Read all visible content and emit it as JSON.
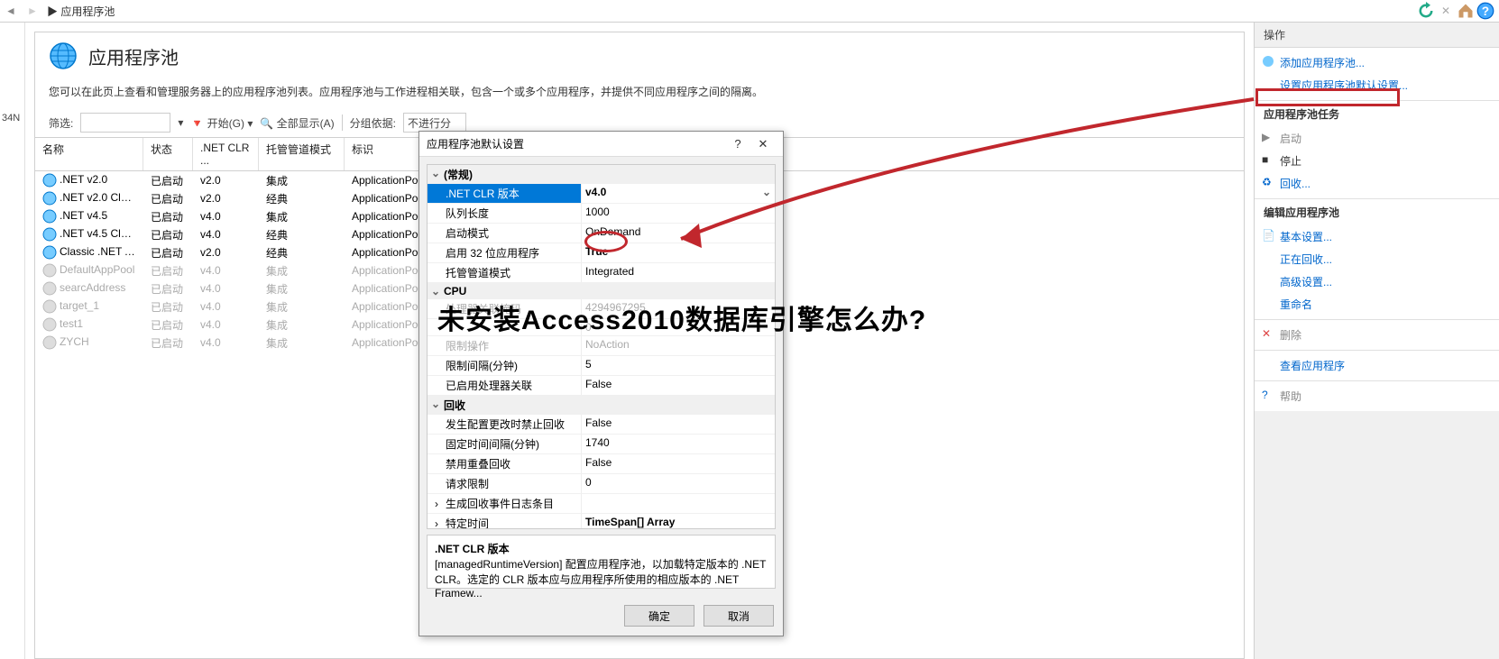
{
  "breadcrumb": "▶ 应用程序池",
  "page_title": "应用程序池",
  "page_description": "您可以在此页上查看和管理服务器上的应用程序池列表。应用程序池与工作进程相关联，包含一个或多个应用程序，并提供不同应用程序之间的隔离。",
  "left_text": "34N",
  "filter": {
    "label": "筛选:",
    "start_label": "开始(G)",
    "show_all": "全部显示(A)",
    "group_by": "分组依据:",
    "group_value": "不进行分"
  },
  "columns": [
    "名称",
    "状态",
    ".NET CLR ...",
    "托管管道模式",
    "标识"
  ],
  "rows": [
    {
      "name": ".NET v2.0",
      "status": "已启动",
      "clr": "v2.0",
      "pipeline": "集成",
      "identity": "ApplicationPoo",
      "disabled": false
    },
    {
      "name": ".NET v2.0 Clas...",
      "status": "已启动",
      "clr": "v2.0",
      "pipeline": "经典",
      "identity": "ApplicationPoo",
      "disabled": false
    },
    {
      "name": ".NET v4.5",
      "status": "已启动",
      "clr": "v4.0",
      "pipeline": "集成",
      "identity": "ApplicationPoo",
      "disabled": false
    },
    {
      "name": ".NET v4.5 Clas...",
      "status": "已启动",
      "clr": "v4.0",
      "pipeline": "经典",
      "identity": "ApplicationPoo",
      "disabled": false
    },
    {
      "name": "Classic .NET A...",
      "status": "已启动",
      "clr": "v2.0",
      "pipeline": "经典",
      "identity": "ApplicationPoo",
      "disabled": false
    },
    {
      "name": "DefaultAppPool",
      "status": "已启动",
      "clr": "v4.0",
      "pipeline": "集成",
      "identity": "ApplicationPoo",
      "disabled": true
    },
    {
      "name": "searcAddress",
      "status": "已启动",
      "clr": "v4.0",
      "pipeline": "集成",
      "identity": "ApplicationPoo",
      "disabled": true
    },
    {
      "name": "target_1",
      "status": "已启动",
      "clr": "v4.0",
      "pipeline": "集成",
      "identity": "ApplicationPoo",
      "disabled": true
    },
    {
      "name": "test1",
      "status": "已启动",
      "clr": "v4.0",
      "pipeline": "集成",
      "identity": "ApplicationPoo",
      "disabled": true
    },
    {
      "name": "ZYCH",
      "status": "已启动",
      "clr": "v4.0",
      "pipeline": "集成",
      "identity": "ApplicationPoo",
      "disabled": true
    }
  ],
  "actions": {
    "title": "操作",
    "add_pool": "添加应用程序池...",
    "set_defaults": "设置应用程序池默认设置...",
    "tasks_title": "应用程序池任务",
    "start": "启动",
    "stop": "停止",
    "recycle": "回收...",
    "edit_title": "编辑应用程序池",
    "basic": "基本设置...",
    "recycling": "正在回收...",
    "advanced": "高级设置...",
    "rename": "重命名",
    "delete": "删除",
    "view_apps": "查看应用程序",
    "help": "帮助"
  },
  "dialog": {
    "title": "应用程序池默认设置",
    "sections": {
      "general": "(常规)",
      "cpu": "CPU",
      "recycle": "回收"
    },
    "props": {
      "clr_version": {
        "k": ".NET CLR 版本",
        "v": "v4.0"
      },
      "queue_length": {
        "k": "队列长度",
        "v": "1000"
      },
      "start_mode": {
        "k": "启动模式",
        "v": "OnDemand"
      },
      "enable_32bit": {
        "k": "启用 32 位应用程序",
        "v": "True"
      },
      "managed_pipeline": {
        "k": "托管管道模式",
        "v": "Integrated"
      },
      "cpu_mask": {
        "k": "处理器关联掩码",
        "v": "4294967295"
      },
      "cpu_mask2": {
        "k": "",
        "v": "0"
      },
      "limit_action": {
        "k": "限制操作",
        "v": "NoAction"
      },
      "limit_interval": {
        "k": "限制间隔(分钟)",
        "v": "5"
      },
      "cpu_affinity_enabled": {
        "k": "已启用处理器关联",
        "v": "False"
      },
      "disable_on_config_change": {
        "k": "发生配置更改时禁止回收",
        "v": "False"
      },
      "fixed_interval": {
        "k": "固定时间间隔(分钟)",
        "v": "1740"
      },
      "disable_overlapping": {
        "k": "禁用重叠回收",
        "v": "False"
      },
      "request_limit": {
        "k": "请求限制",
        "v": "0"
      },
      "generate_log": {
        "k": "生成回收事件日志条目",
        "v": ""
      },
      "specific_time": {
        "k": "特定时间",
        "v": "TimeSpan[] Array"
      }
    },
    "desc_title": ".NET CLR 版本",
    "desc_body": "[managedRuntimeVersion] 配置应用程序池，以加载特定版本的 .NET CLR。选定的 CLR 版本应与应用程序所使用的相应版本的 .NET Framew...",
    "ok": "确定",
    "cancel": "取消"
  },
  "overlay_text": "未安装Access2010数据库引擎怎么办?"
}
